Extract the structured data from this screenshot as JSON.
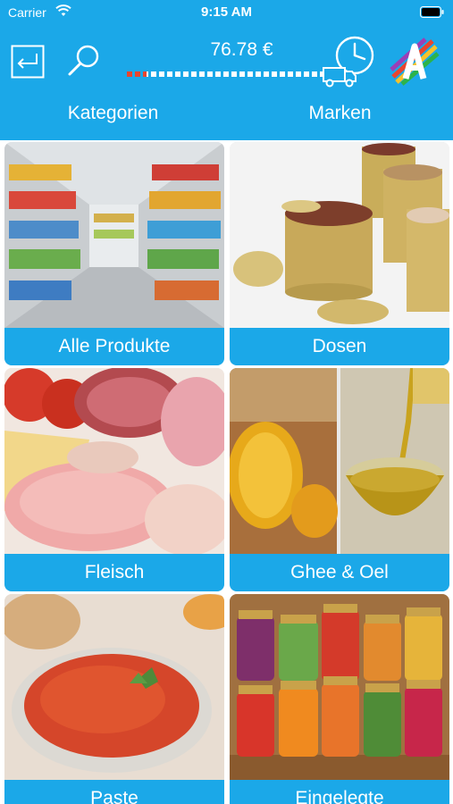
{
  "status_bar": {
    "carrier": "Carrier",
    "time": "9:15 AM"
  },
  "header": {
    "cart_total": "76.78 €",
    "delivery_progress": 0.1,
    "tabs": [
      {
        "label": "Kategorien"
      },
      {
        "label": "Marken"
      }
    ]
  },
  "categories": [
    {
      "label": "Alle Produkte"
    },
    {
      "label": "Dosen"
    },
    {
      "label": "Fleisch"
    },
    {
      "label": "Ghee & Oel"
    },
    {
      "label": "Paste"
    },
    {
      "label": "Eingelegte"
    }
  ],
  "colors": {
    "header_blue": "#1ba8e8",
    "progress_red": "#e8452e",
    "text_white": "#ffffff"
  },
  "icons": [
    "wifi-icon",
    "battery-icon",
    "back-icon",
    "search-icon",
    "delivery-truck-icon",
    "clock-icon",
    "app-logo"
  ]
}
